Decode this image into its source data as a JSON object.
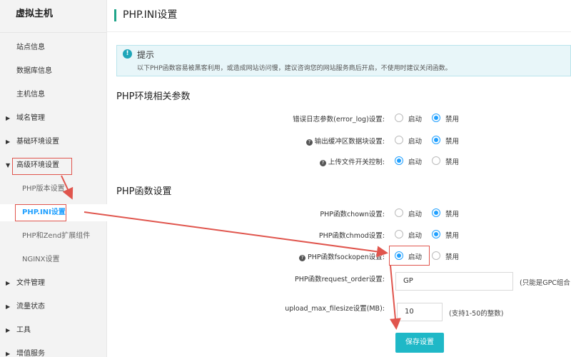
{
  "sidebar": {
    "title": "虚拟主机",
    "items": [
      {
        "label": "站点信息"
      },
      {
        "label": "数据库信息"
      },
      {
        "label": "主机信息"
      },
      {
        "label": "域名管理"
      },
      {
        "label": "基础环境设置"
      },
      {
        "label": "高级环境设置"
      },
      {
        "label": "PHP版本设置"
      },
      {
        "label": "PHP.INI设置"
      },
      {
        "label": "PHP和Zend扩展组件"
      },
      {
        "label": "NGINX设置"
      },
      {
        "label": "文件管理"
      },
      {
        "label": "流量状态"
      },
      {
        "label": "工具"
      },
      {
        "label": "增值服务"
      }
    ]
  },
  "page": {
    "title": "PHP.INI设置"
  },
  "notice": {
    "title": "提示",
    "text": "以下PHP函数容易被黑客利用，或造成网站访问慢，建议咨询您的网站服务商后开启，不使用时建议关闭函数。",
    "icon": "info-icon"
  },
  "env_section": {
    "title": "PHP环境相关参数",
    "rows": [
      {
        "label": "错误日志参数(error_log)设置:",
        "selected": "off"
      },
      {
        "label": "输出缓冲区数据块设置:",
        "selected": "off"
      },
      {
        "label": "上传文件开关控制:",
        "selected": "on"
      }
    ]
  },
  "func_section": {
    "title": "PHP函数设置",
    "rows": [
      {
        "label": "PHP函数chown设置:",
        "selected": "off"
      },
      {
        "label": "PHP函数chmod设置:",
        "selected": "off"
      },
      {
        "label": "PHP函数fsockopen设置:",
        "selected": "on"
      }
    ],
    "request_order": {
      "label": "PHP函数request_order设置:",
      "value": "GP",
      "hint": "(只能是GPC组合"
    },
    "upload_max": {
      "label": "upload_max_filesize设置(MB):",
      "value": "10",
      "hint": "(支持1-50的整数)"
    }
  },
  "radio_labels": {
    "on": "启动",
    "off": "禁用"
  },
  "save_label": "保存设置",
  "colors": {
    "accent": "#20a0ff",
    "button": "#1fb8c7",
    "annotation": "#e0554d"
  }
}
